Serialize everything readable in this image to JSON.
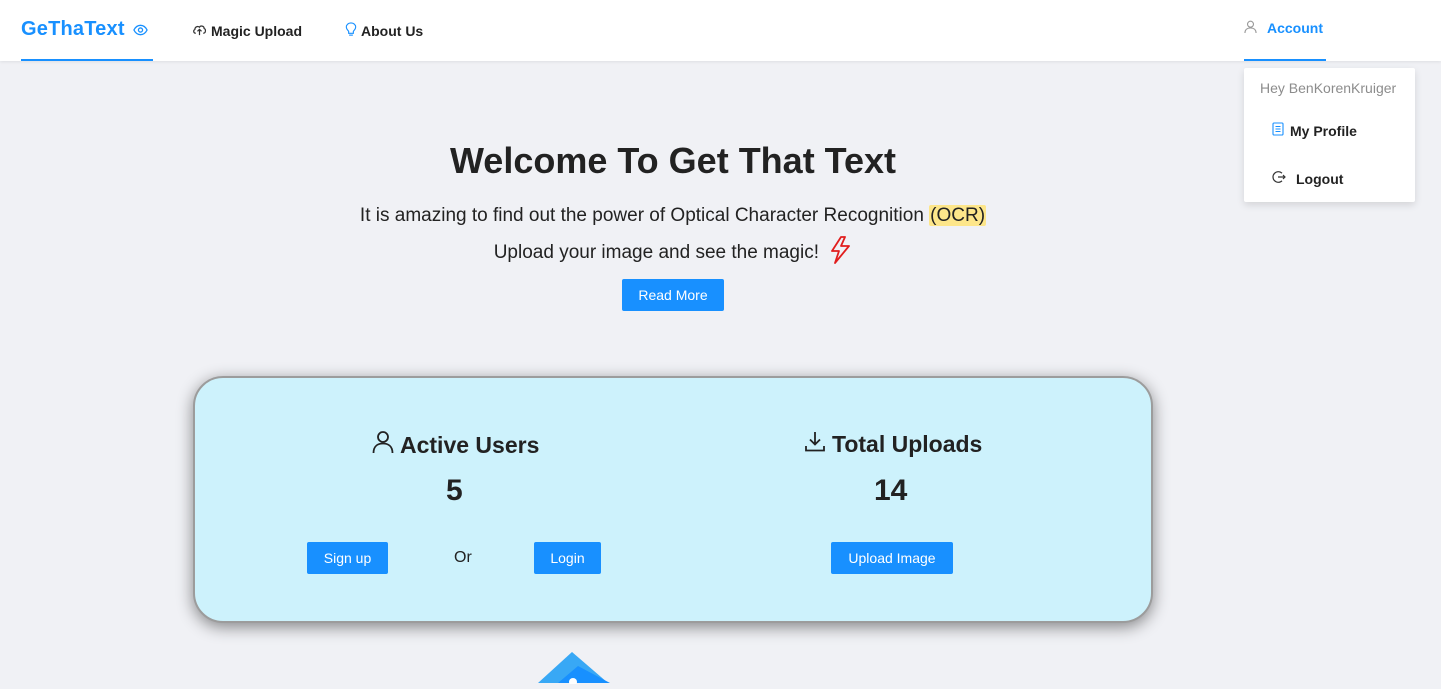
{
  "navbar": {
    "logo_text": "GeThaText",
    "magic_upload": "Magic Upload",
    "about_us": "About Us",
    "account": "Account"
  },
  "dropdown": {
    "greeting": "Hey BenKorenKruiger",
    "my_profile": "My Profile",
    "logout": "Logout"
  },
  "hero": {
    "title": "Welcome To Get That Text",
    "line1_prefix": "It is amazing to find out the power of Optical Character Recognition ",
    "line1_highlight": "(OCR)",
    "line2": "Upload your image and see the magic!",
    "read_more": "Read More"
  },
  "stats": {
    "active_users_label": "Active Users",
    "active_users_value": "5",
    "total_uploads_label": "Total Uploads",
    "total_uploads_value": "14",
    "signup": "Sign up",
    "or": "Or",
    "login": "Login",
    "upload_image": "Upload Image"
  },
  "colors": {
    "accent": "#1890ff",
    "card_bg": "#cdf2fc",
    "page_bg": "#f0f1f5",
    "highlight": "#fde68a",
    "bolt": "#e11d1d"
  },
  "icons": [
    "eye-icon",
    "cloud-upload-icon",
    "bulb-icon",
    "user-icon",
    "profile-doc-icon",
    "logout-icon",
    "lightning-icon",
    "download-icon"
  ]
}
